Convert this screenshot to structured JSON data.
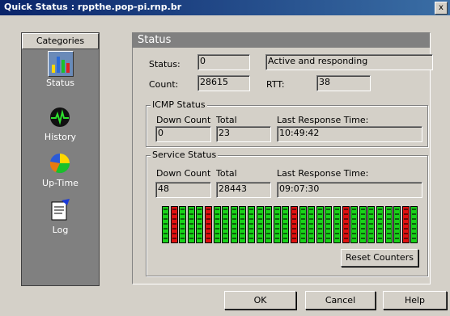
{
  "window": {
    "title": "Quick Status : rppthe.pop-pi.rnp.br",
    "close_label": "x"
  },
  "categories": {
    "header": "Categories",
    "items": [
      {
        "label": "Status",
        "icon": "status-bar-chart-icon",
        "selected": true
      },
      {
        "label": "History",
        "icon": "history-heartbeat-icon",
        "selected": false
      },
      {
        "label": "Up-Time",
        "icon": "uptime-pie-icon",
        "selected": false
      },
      {
        "label": "Log",
        "icon": "log-notepad-icon",
        "selected": false
      }
    ]
  },
  "status_panel": {
    "header": "Status",
    "status_label": "Status:",
    "status_value": "0",
    "status_text": "Active and responding",
    "count_label": "Count:",
    "count_value": "28615",
    "rtt_label": "RTT:",
    "rtt_value": "38"
  },
  "icmp": {
    "title": "ICMP Status",
    "down_count_label": "Down Count",
    "total_label": "Total",
    "last_label": "Last Response Time:",
    "down_count": "0",
    "total": "23",
    "last_response": "10:49:42"
  },
  "service": {
    "title": "Service Status",
    "down_count_label": "Down Count",
    "total_label": "Total",
    "last_label": "Last Response Time:",
    "down_count": "48",
    "total": "28443",
    "last_response": "09:07:30",
    "history": [
      "up",
      "down",
      "up",
      "up",
      "up",
      "down",
      "up",
      "up",
      "up",
      "up",
      "up",
      "up",
      "up",
      "up",
      "up",
      "down",
      "up",
      "up",
      "up",
      "up",
      "up",
      "down",
      "up",
      "up",
      "up",
      "up",
      "up",
      "up",
      "down",
      "up"
    ],
    "colors": {
      "up": "#19d219",
      "down": "#e01010",
      "unknown": "#8a8a8a"
    },
    "reset_label": "Reset Counters"
  },
  "buttons": {
    "ok": "OK",
    "cancel": "Cancel",
    "help": "Help"
  }
}
